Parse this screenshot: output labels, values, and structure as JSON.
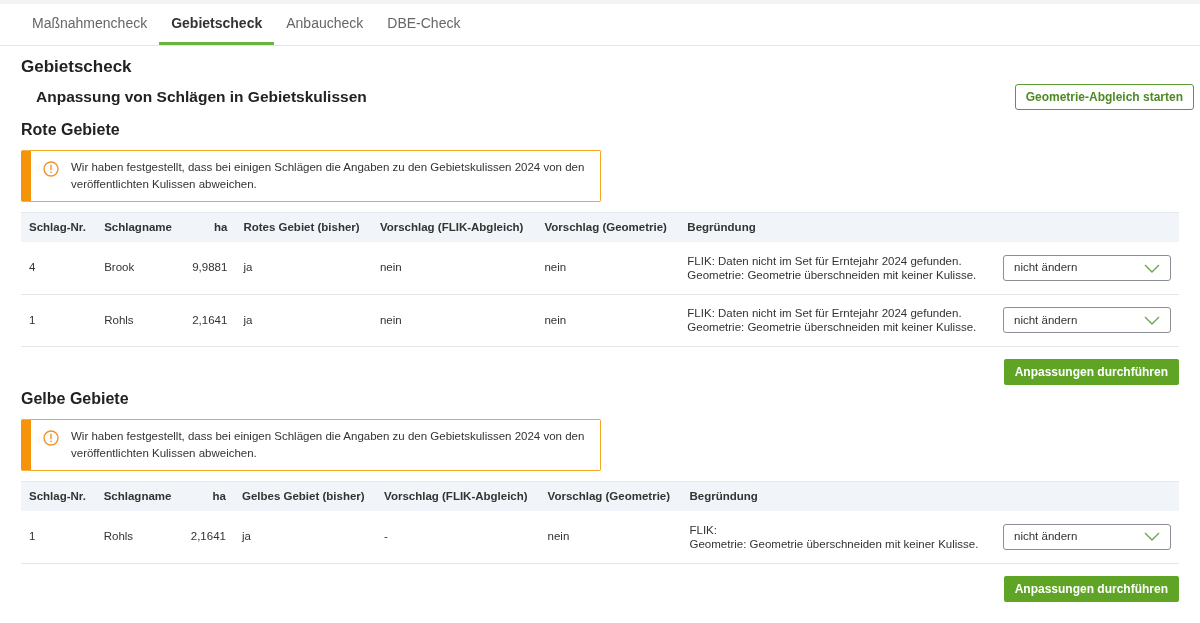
{
  "tabs": [
    {
      "label": "Maßnahmencheck",
      "selected": false
    },
    {
      "label": "Gebietscheck",
      "selected": true
    },
    {
      "label": "Anbaucheck",
      "selected": false
    },
    {
      "label": "DBE-Check",
      "selected": false
    }
  ],
  "page_title": "Gebietscheck",
  "subtitle": "Anpassung von Schlägen in Gebietskulissen",
  "geometry_button": "Geometrie-Abgleich starten",
  "sections": [
    {
      "title": "Rote Gebiete",
      "alert": "Wir haben festgestellt, dass bei einigen Schlägen die Angaben zu den Gebietskulissen 2024 von den veröffentlichten Kulissen abweichen.",
      "columns": [
        "Schlag-Nr.",
        "Schlagname",
        "ha",
        "Rotes Gebiet (bisher)",
        "Vorschlag (FLIK-Abgleich)",
        "Vorschlag (Geometrie)",
        "Begründung"
      ],
      "rows": [
        {
          "cells": [
            "4",
            "Brook",
            "9,9881",
            "ja",
            "nein",
            "nein"
          ],
          "reason": [
            "FLIK: Daten nicht im Set für Erntejahr 2024 gefunden.",
            "Geometrie: Geometrie überschneiden mit keiner Kulisse."
          ],
          "choice": "nicht ändern"
        },
        {
          "cells": [
            "1",
            "Rohls",
            "2,1641",
            "ja",
            "nein",
            "nein"
          ],
          "reason": [
            "FLIK: Daten nicht im Set für Erntejahr 2024 gefunden.",
            "Geometrie: Geometrie überschneiden mit keiner Kulisse."
          ],
          "choice": "nicht ändern"
        }
      ],
      "button": "Anpassungen durchführen"
    },
    {
      "title": "Gelbe Gebiete",
      "alert": "Wir haben festgestellt, dass bei einigen Schlägen die Angaben zu den Gebietskulissen 2024 von den veröffentlichten Kulissen abweichen.",
      "columns": [
        "Schlag-Nr.",
        "Schlagname",
        "ha",
        "Gelbes Gebiet (bisher)",
        "Vorschlag (FLIK-Abgleich)",
        "Vorschlag (Geometrie)",
        "Begründung"
      ],
      "rows": [
        {
          "cells": [
            "1",
            "Rohls",
            "2,1641",
            "ja",
            "-",
            "nein"
          ],
          "reason": [
            "FLIK:",
            "Geometrie: Geometrie überschneiden mit keiner Kulisse."
          ],
          "choice": "nicht ändern"
        }
      ],
      "button": "Anpassungen durchführen"
    }
  ]
}
